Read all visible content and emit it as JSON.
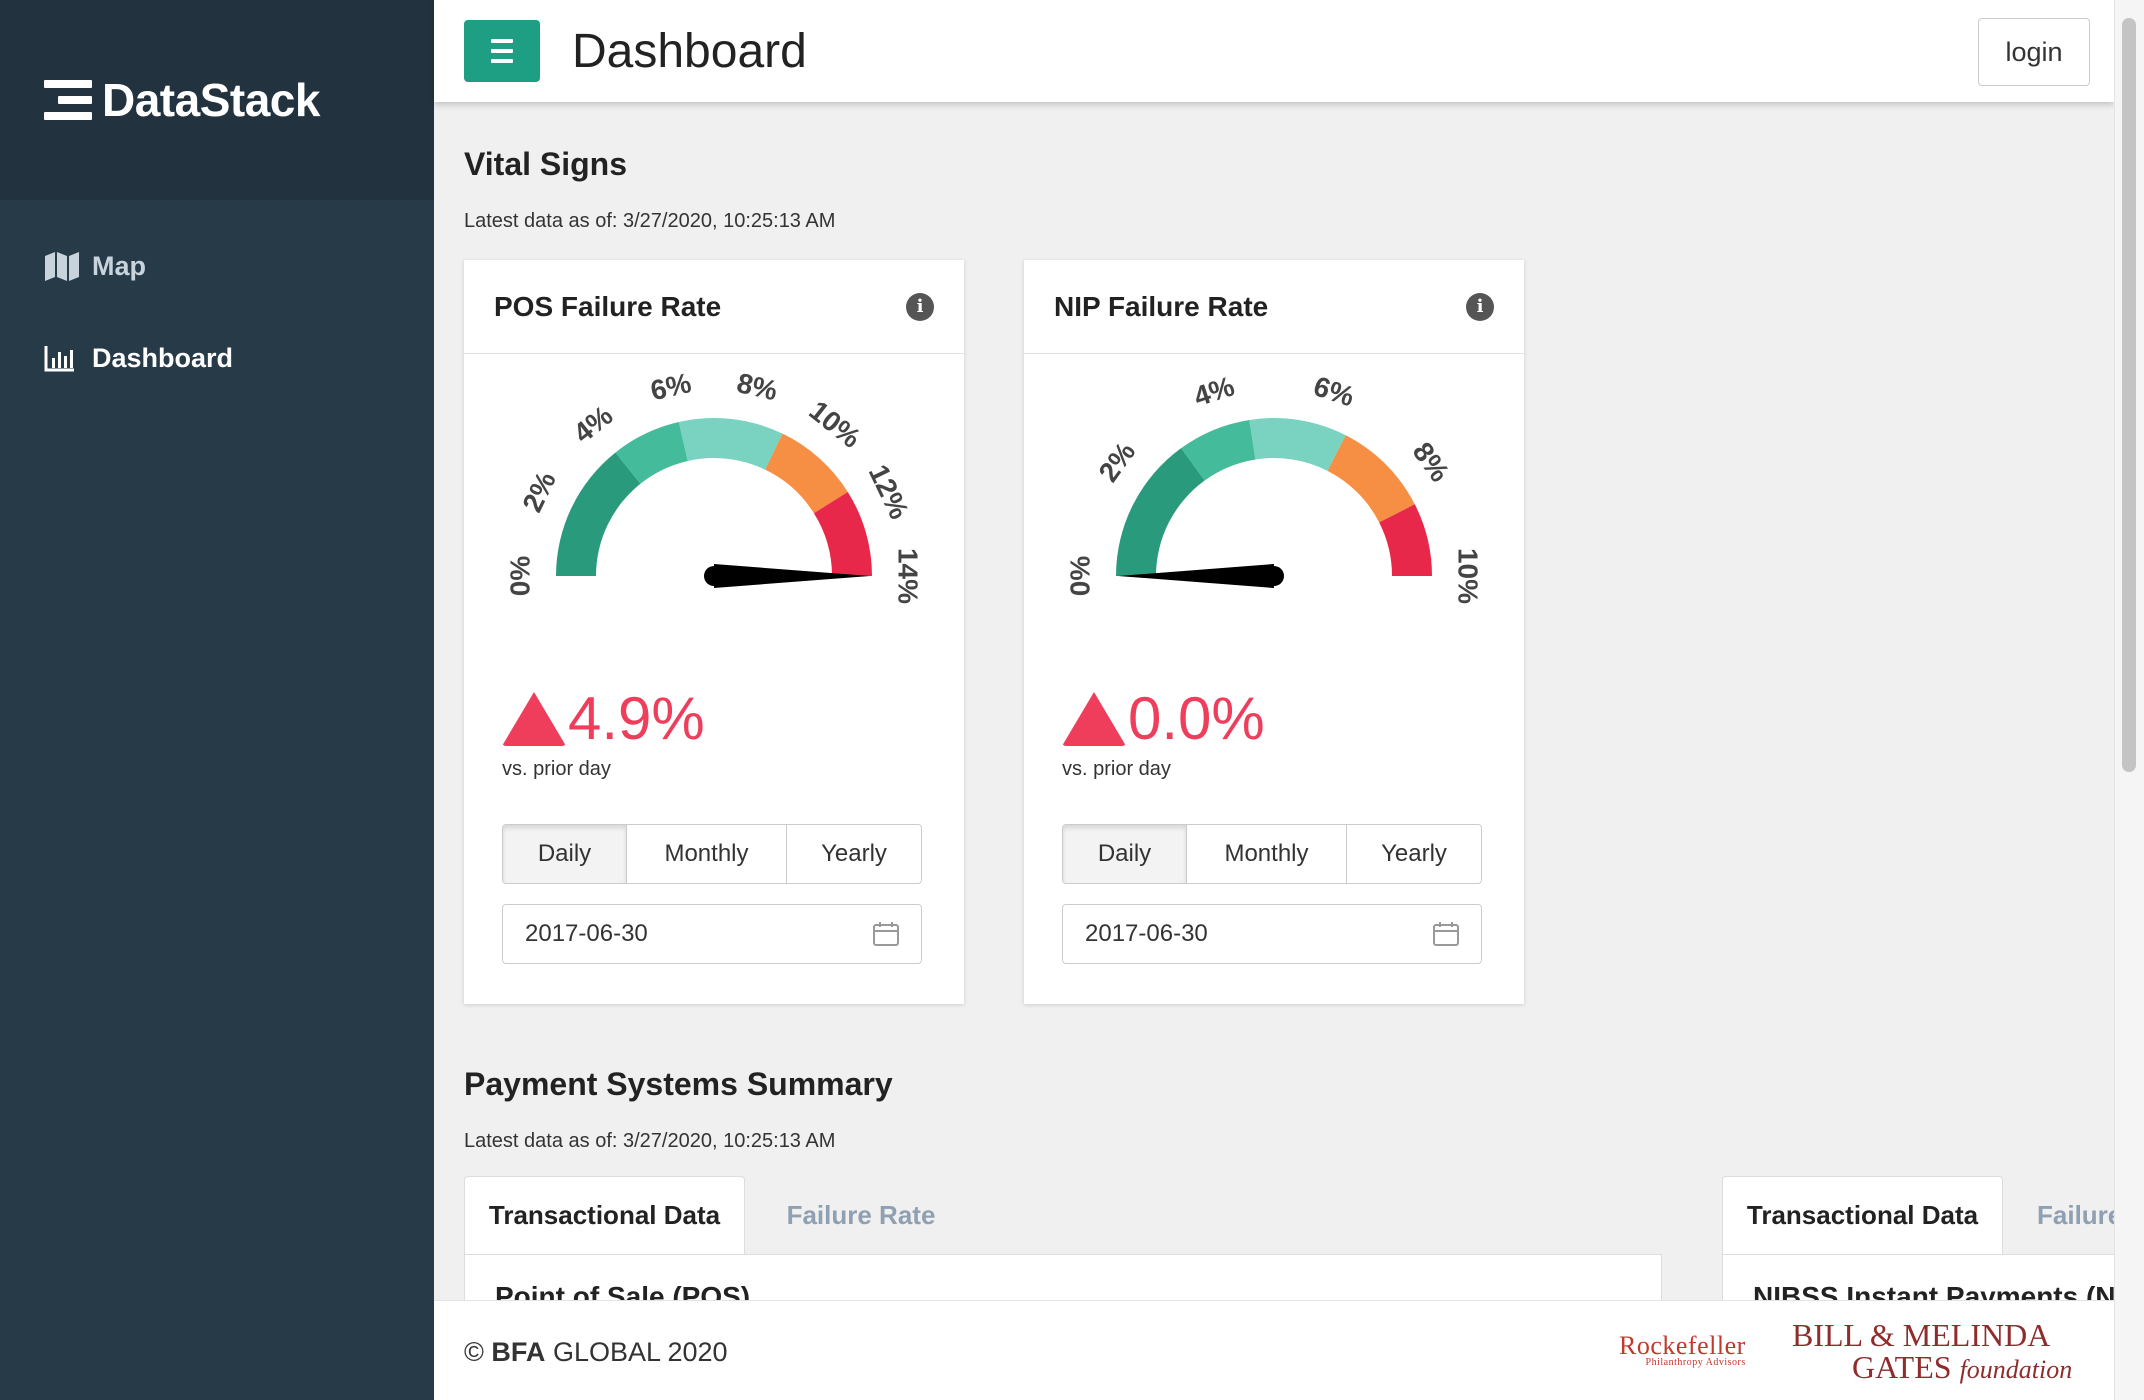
{
  "app": {
    "brand": "DataStack",
    "page_title": "Dashboard",
    "login_label": "login"
  },
  "sidebar": {
    "items": [
      {
        "label": "Map",
        "icon": "map-icon"
      },
      {
        "label": "Dashboard",
        "icon": "bar-chart-icon"
      }
    ]
  },
  "vital_signs": {
    "title": "Vital Signs",
    "latest": "Latest data as of: 3/27/2020, 10:25:13 AM",
    "cards": [
      {
        "title": "POS Failure Rate",
        "gauge": {
          "min": 0,
          "max": 14,
          "value": 14,
          "tick_labels": [
            "0%",
            "2%",
            "4%",
            "6%",
            "8%",
            "10%",
            "12%",
            "14%"
          ],
          "bands": [
            {
              "from": 0,
              "to": 4,
              "color": "#2a9a7c"
            },
            {
              "from": 4,
              "to": 6,
              "color": "#44bb9a"
            },
            {
              "from": 6,
              "to": 9,
              "color": "#79d3c0"
            },
            {
              "from": 9,
              "to": 11.5,
              "color": "#f68e43"
            },
            {
              "from": 11.5,
              "to": 14,
              "color": "#e8284b"
            }
          ]
        },
        "change_value": "4.9%",
        "change_label": "vs. prior day",
        "periods": [
          "Daily",
          "Monthly",
          "Yearly"
        ],
        "active_period": "Daily",
        "date": "2017-06-30"
      },
      {
        "title": "NIP Failure Rate",
        "gauge": {
          "min": 0,
          "max": 10,
          "value": 0,
          "tick_labels": [
            "0%",
            "2%",
            "4%",
            "6%",
            "8%",
            "10%"
          ],
          "bands": [
            {
              "from": 0,
              "to": 3,
              "color": "#2a9a7c"
            },
            {
              "from": 3,
              "to": 4.5,
              "color": "#44bb9a"
            },
            {
              "from": 4.5,
              "to": 6.5,
              "color": "#79d3c0"
            },
            {
              "from": 6.5,
              "to": 8.5,
              "color": "#f68e43"
            },
            {
              "from": 8.5,
              "to": 10,
              "color": "#e8284b"
            }
          ]
        },
        "change_value": "0.0%",
        "change_label": "vs. prior day",
        "periods": [
          "Daily",
          "Monthly",
          "Yearly"
        ],
        "active_period": "Daily",
        "date": "2017-06-30"
      }
    ]
  },
  "payment_summary": {
    "title": "Payment Systems Summary",
    "latest": "Latest data as of: 3/27/2020, 10:25:13 AM",
    "panel_left": {
      "tabs": [
        "Transactional Data",
        "Failure Rate"
      ],
      "body_title": "Point of Sale (POS)"
    },
    "panel_right": {
      "tabs": [
        "Transactional Data",
        "Failure"
      ],
      "body_title": "NIBSS Instant Payments (NIP)"
    }
  },
  "footer": {
    "copyright_symbol": "©",
    "company_bold": "BFA",
    "company_rest": "GLOBAL 2020",
    "partner1": "Rockefeller",
    "partner1_sub": "Philanthropy Advisors",
    "partner2_line1": "BILL & MELINDA",
    "partner2_line2": "GATES",
    "partner2_suffix": "foundation"
  }
}
